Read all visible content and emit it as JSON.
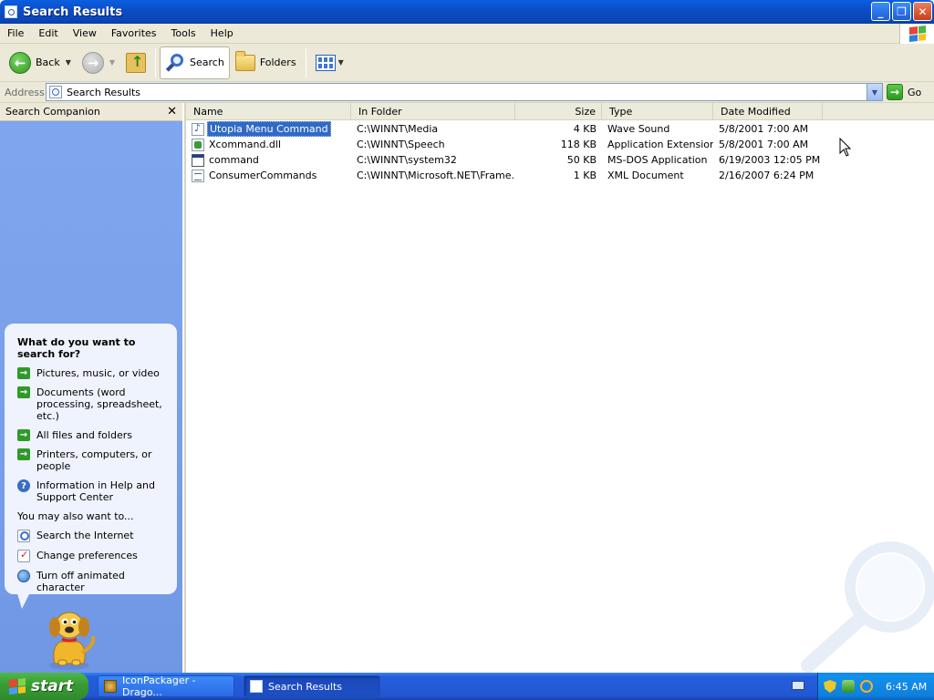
{
  "window": {
    "title": "Search Results"
  },
  "menubar": {
    "items": [
      "File",
      "Edit",
      "View",
      "Favorites",
      "Tools",
      "Help"
    ]
  },
  "toolbar": {
    "back_label": "Back",
    "search_label": "Search",
    "folders_label": "Folders"
  },
  "addressbar": {
    "label": "Address",
    "value": "Search Results",
    "go_label": "Go"
  },
  "companion": {
    "header_title": "Search Companion",
    "close_glyph": "✕",
    "question": "What do you want to search for?",
    "options": [
      "Pictures, music, or video",
      "Documents (word processing, spreadsheet, etc.)",
      "All files and folders",
      "Printers, computers, or people",
      "Information in Help and Support Center"
    ],
    "also_label": "You may also want to...",
    "also_options": [
      "Search the Internet",
      "Change preferences",
      "Turn off animated character"
    ]
  },
  "filelist": {
    "columns": [
      "Name",
      "In Folder",
      "Size",
      "Type",
      "Date Modified"
    ],
    "rows": [
      {
        "name": "Utopia Menu Command",
        "folder": "C:\\WINNT\\Media",
        "size": "4 KB",
        "type": "Wave Sound",
        "date": "5/8/2001 7:00 AM",
        "icon": "wave-file-icon"
      },
      {
        "name": "Xcommand.dll",
        "folder": "C:\\WINNT\\Speech",
        "size": "118 KB",
        "type": "Application Extension",
        "date": "5/8/2001 7:00 AM",
        "icon": "dll-file-icon"
      },
      {
        "name": "command",
        "folder": "C:\\WINNT\\system32",
        "size": "50 KB",
        "type": "MS-DOS Application",
        "date": "6/19/2003 12:05 PM",
        "icon": "dos-app-icon"
      },
      {
        "name": "ConsumerCommands",
        "folder": "C:\\WINNT\\Microsoft.NET\\Frame...",
        "size": "1 KB",
        "type": "XML Document",
        "date": "2/16/2007 6:24 PM",
        "icon": "xml-file-icon"
      }
    ],
    "selected_index": 0
  },
  "taskbar": {
    "start_label": "start",
    "tasks": [
      "IconPackager - Drago...",
      "Search Results"
    ],
    "active_task_index": 1,
    "clock": "6:45 AM"
  },
  "colors": {
    "titlebar": "#0b4ec7",
    "companion_bg": "#7aa0ea",
    "selection": "#316ac5",
    "start_green": "#3a9d36"
  }
}
